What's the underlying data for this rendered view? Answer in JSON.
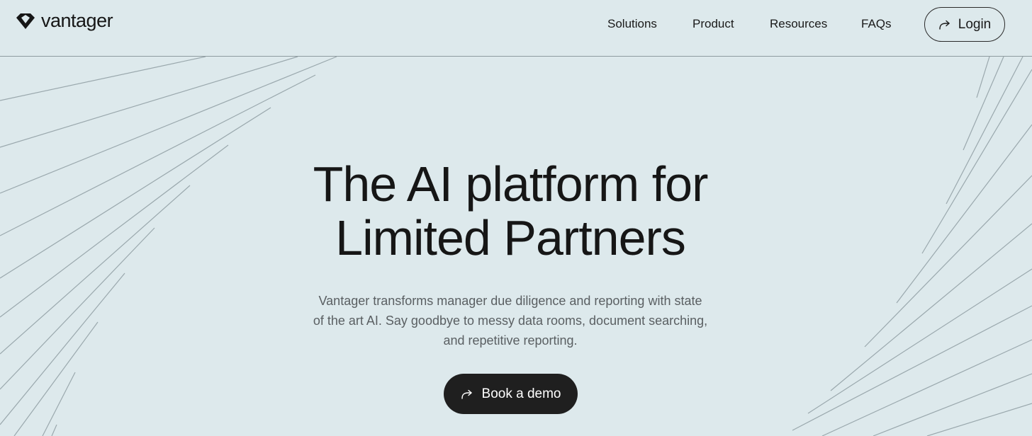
{
  "brand": {
    "logo_icon": "gem-logo-icon",
    "name": "vantager"
  },
  "nav": {
    "links": [
      {
        "label": "Solutions"
      },
      {
        "label": "Product"
      },
      {
        "label": "Resources"
      },
      {
        "label": "FAQs"
      }
    ],
    "login": {
      "label": "Login",
      "icon": "curved-arrow-icon"
    }
  },
  "hero": {
    "title_lines": [
      "The AI platform for",
      "Limited Partners"
    ],
    "subtitle_lines": [
      "Vantager transforms manager due diligence and reporting with state",
      "of the art AI. Say goodbye to messy data rooms, document searching,",
      "and repetitive reporting."
    ],
    "cta": {
      "label": "Book a demo",
      "icon": "curved-arrow-icon"
    }
  },
  "colors": {
    "background": "#dde9ec",
    "text": "#161616",
    "subtitle": "#5a5f62",
    "button_dark": "#1f1f1f",
    "lines": "#9aa8ad"
  }
}
